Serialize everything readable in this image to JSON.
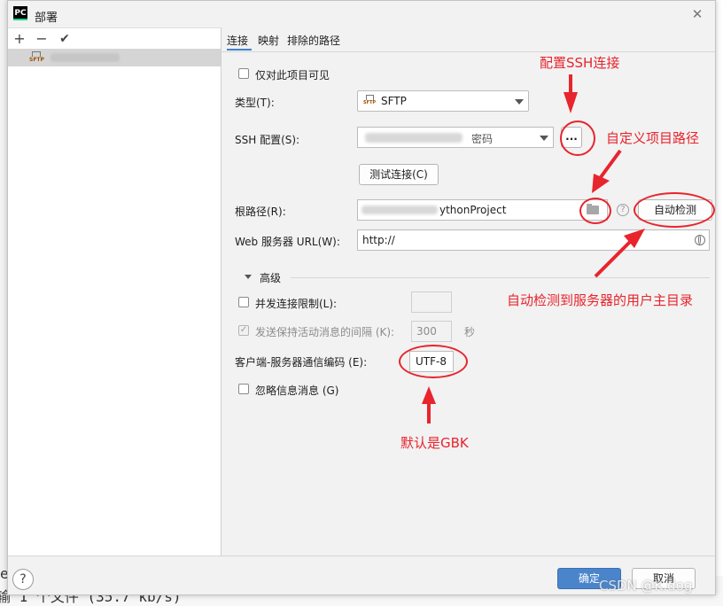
{
  "window": {
    "title": "部署",
    "app_logo": "PC",
    "close_glyph": "✕"
  },
  "left_toolbar": {
    "add": "+",
    "remove": "−",
    "check": "✔"
  },
  "server_list": {
    "icon_label": "SFTP"
  },
  "tabs": [
    "连接",
    "映射",
    "排除的路径"
  ],
  "form": {
    "visible_only_project": "仅对此项目可见",
    "type_label": "类型(T):",
    "type_value": "SFTP",
    "ssh_label": "SSH 配置(S):",
    "ssh_value_suffix": "密码",
    "ssh_more_button": "...",
    "test_button": "测试连接(C)",
    "root_label": "根路径(R):",
    "root_value_tail": "ythonProject",
    "auto_detect_button": "自动检测",
    "web_url_label": "Web 服务器 URL(W):",
    "web_url_value": "http://",
    "advanced_header": "高级",
    "concurrent_label": "并发连接限制(L):",
    "keepalive_label": "发送保持活动消息的间隔 (K):",
    "keepalive_value": "300",
    "keepalive_unit": "秒",
    "encoding_label": "客户端-服务器通信编码 (E):",
    "encoding_value": "UTF-8",
    "ignore_info_label": "忽略信息消息 (G)"
  },
  "annotations": {
    "config_ssh": "配置SSH连接",
    "custom_path": "自定义项目路径",
    "auto_detect_note": "自动检测到服务器的用户主目录",
    "default_gbk": "默认是GBK",
    "color": "#e8242d"
  },
  "bottom": {
    "help": "?",
    "ok": "确定",
    "cancel": "取消"
  },
  "watermark": "CSDN @K.dog",
  "background_text": {
    "line1": "e",
    "line2": "输 1 个文件 (35.7 kb/s)"
  }
}
